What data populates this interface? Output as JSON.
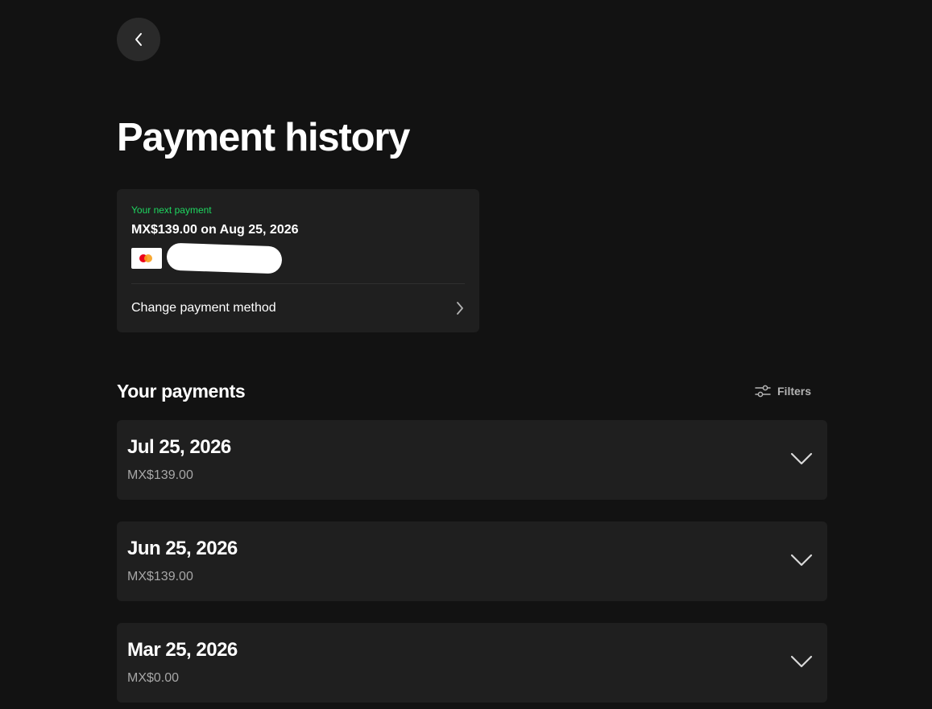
{
  "navigation": {
    "back_icon": "chevron-left-icon"
  },
  "page": {
    "title": "Payment history"
  },
  "next_payment": {
    "label": "Your next payment",
    "amount_text": "MX$139.00 on Aug 25, 2026",
    "card_brand_icon": "mastercard-icon",
    "change_method_label": "Change payment method",
    "accent_color": "#1ed760"
  },
  "payments_section": {
    "title": "Your payments",
    "filters_label": "Filters",
    "filters_icon": "sliders-icon"
  },
  "payments": [
    {
      "date": "Jul 25, 2026",
      "amount": "MX$139.00"
    },
    {
      "date": "Jun 25, 2026",
      "amount": "MX$139.00"
    },
    {
      "date": "Mar 25, 2026",
      "amount": "MX$0.00"
    }
  ],
  "colors": {
    "background": "#121212",
    "card": "#1f1f1f",
    "muted_text": "#a7a7a7"
  }
}
